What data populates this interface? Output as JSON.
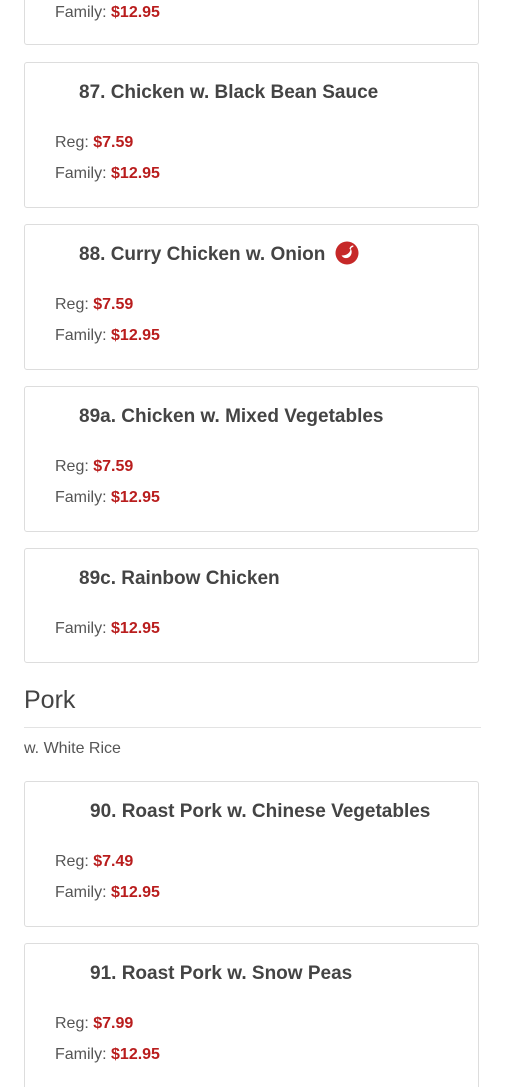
{
  "colors": {
    "price": "#b91d1d",
    "text": "#555555",
    "border": "#dddddd",
    "spicy_icon": "#c62828"
  },
  "partial_item": {
    "family_label": "Family:",
    "family_price": "$12.95"
  },
  "items": [
    {
      "title": "87. Chicken w. Black Bean Sauce",
      "reg_label": "Reg:",
      "reg_price": "$7.59",
      "family_label": "Family:",
      "family_price": "$12.95"
    },
    {
      "title": "88. Curry Chicken w. Onion",
      "icon": "spicy-pepper-icon",
      "reg_label": "Reg:",
      "reg_price": "$7.59",
      "family_label": "Family:",
      "family_price": "$12.95"
    },
    {
      "title": "89a. Chicken w. Mixed Vegetables",
      "reg_label": "Reg:",
      "reg_price": "$7.59",
      "family_label": "Family:",
      "family_price": "$12.95"
    },
    {
      "title": "89c. Rainbow Chicken",
      "family_label": "Family:",
      "family_price": "$12.95"
    }
  ],
  "section": {
    "title": "Pork",
    "note": "w. White Rice"
  },
  "pork_items": [
    {
      "title": "90. Roast Pork w. Chinese Vegetables",
      "reg_label": "Reg:",
      "reg_price": "$7.49",
      "family_label": "Family:",
      "family_price": "$12.95"
    },
    {
      "title": "91. Roast Pork w. Snow Peas",
      "reg_label": "Reg:",
      "reg_price": "$7.99",
      "family_label": "Family:",
      "family_price": "$12.95"
    }
  ]
}
